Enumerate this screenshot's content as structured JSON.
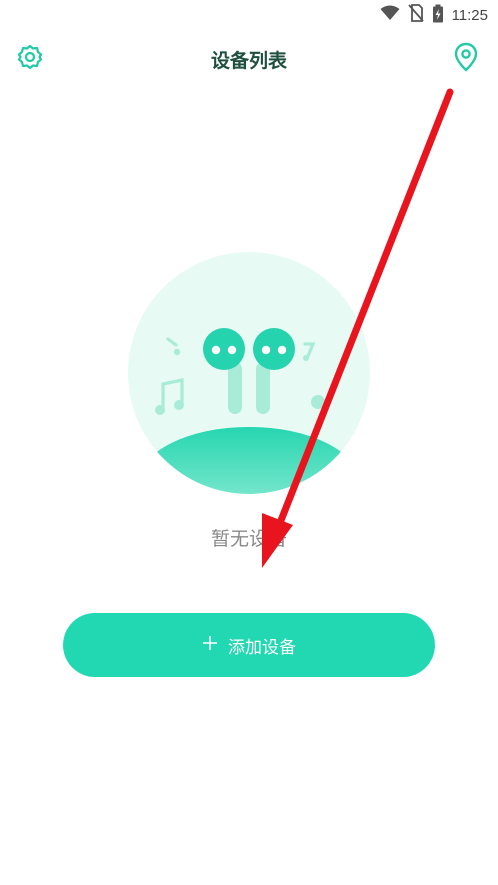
{
  "status_bar": {
    "time": "11:25",
    "icons": [
      "wifi-icon",
      "no-sim-icon",
      "battery-charging-icon"
    ]
  },
  "header": {
    "title": "设备列表",
    "left_icon": "gear-icon",
    "right_icon": "location-pin-icon"
  },
  "empty_state": {
    "message": "暂无设备",
    "illustration": "earbuds-music-illustration"
  },
  "add_button": {
    "icon": "plus-icon",
    "label": "添加设备"
  },
  "colors": {
    "accent": "#22d8b3",
    "title": "#1f4f3f",
    "circle_bg": "#e8faf4",
    "annotation_arrow": "#e8141e"
  },
  "annotation": "red-arrow-pointing-at-empty-state"
}
